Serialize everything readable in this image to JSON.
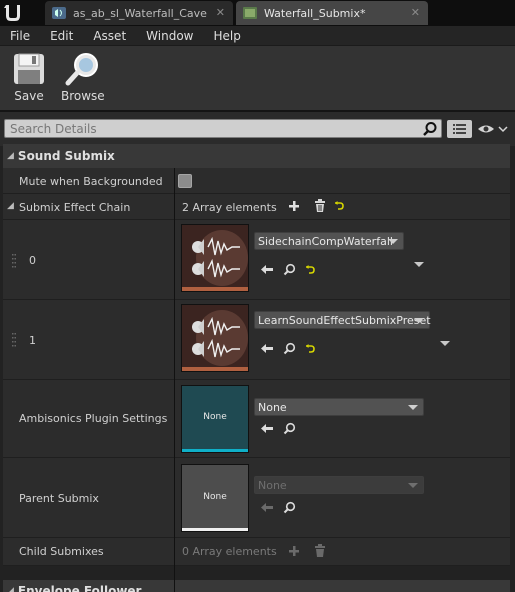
{
  "tabs": [
    {
      "label": "as_ab_sl_Waterfall_Cave"
    },
    {
      "label": "Waterfall_Submix*"
    }
  ],
  "menu": {
    "items": [
      "File",
      "Edit",
      "Asset",
      "Window",
      "Help"
    ]
  },
  "toolbar": {
    "save_label": "Save",
    "browse_label": "Browse"
  },
  "search": {
    "placeholder": "Search Details"
  },
  "category": {
    "title": "Sound Submix"
  },
  "properties": {
    "mute_label": "Mute when Backgrounded",
    "mute_checked": false,
    "effect_chain_label": "Submix Effect Chain",
    "effect_chain_value": "2 Array elements",
    "elements": [
      {
        "index": "0",
        "preset": "SidechainCompWaterfall"
      },
      {
        "index": "1",
        "preset": "LearnSoundEffectSubmixPreset"
      }
    ],
    "ambisonics_label": "Ambisonics Plugin Settings",
    "ambisonics_thumb": "None",
    "ambisonics_value": "None",
    "parent_label": "Parent Submix",
    "parent_thumb": "None",
    "parent_value": "None",
    "child_label": "Child Submixes",
    "child_value": "0 Array elements"
  },
  "next_category": {
    "title": "Envelope Follower"
  },
  "colors": {
    "accent_reset": "#d6d600",
    "ambisonics_bar": "#0fb0c8",
    "ambisonics_bg": "#1f4a52"
  }
}
